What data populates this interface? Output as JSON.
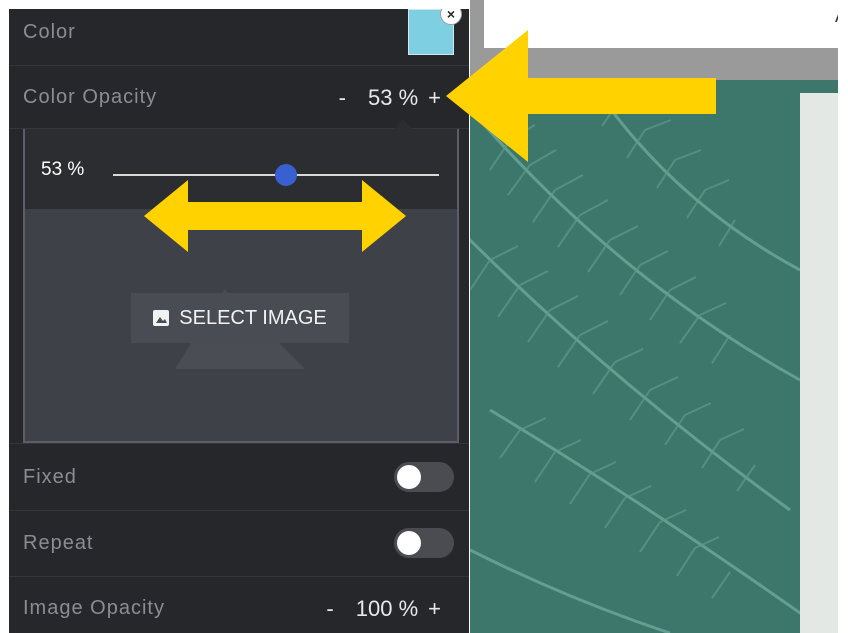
{
  "panel": {
    "color": {
      "label": "Color",
      "swatch_color": "#7ecfe2",
      "close_icon": "×"
    },
    "color_opacity": {
      "label": "Color Opacity",
      "minus": "-",
      "value": "53 %",
      "plus": "+"
    },
    "slider": {
      "value_text": "53 %",
      "level": 0.53
    },
    "image": {
      "button_label": "SELECT IMAGE",
      "icon": "image-icon"
    },
    "fixed": {
      "label": "Fixed",
      "on": false
    },
    "repeat": {
      "label": "Repeat",
      "on": false
    },
    "image_opacity": {
      "label": "Image Opacity",
      "minus": "-",
      "value": "100 %",
      "plus": "+"
    }
  },
  "preview": {
    "top_char": "A"
  },
  "colors": {
    "panel_bg": "#25272b",
    "accent_arrow": "#ffd200",
    "slider_thumb": "#3a5fd0",
    "fern_green": "#3f7a6e"
  }
}
